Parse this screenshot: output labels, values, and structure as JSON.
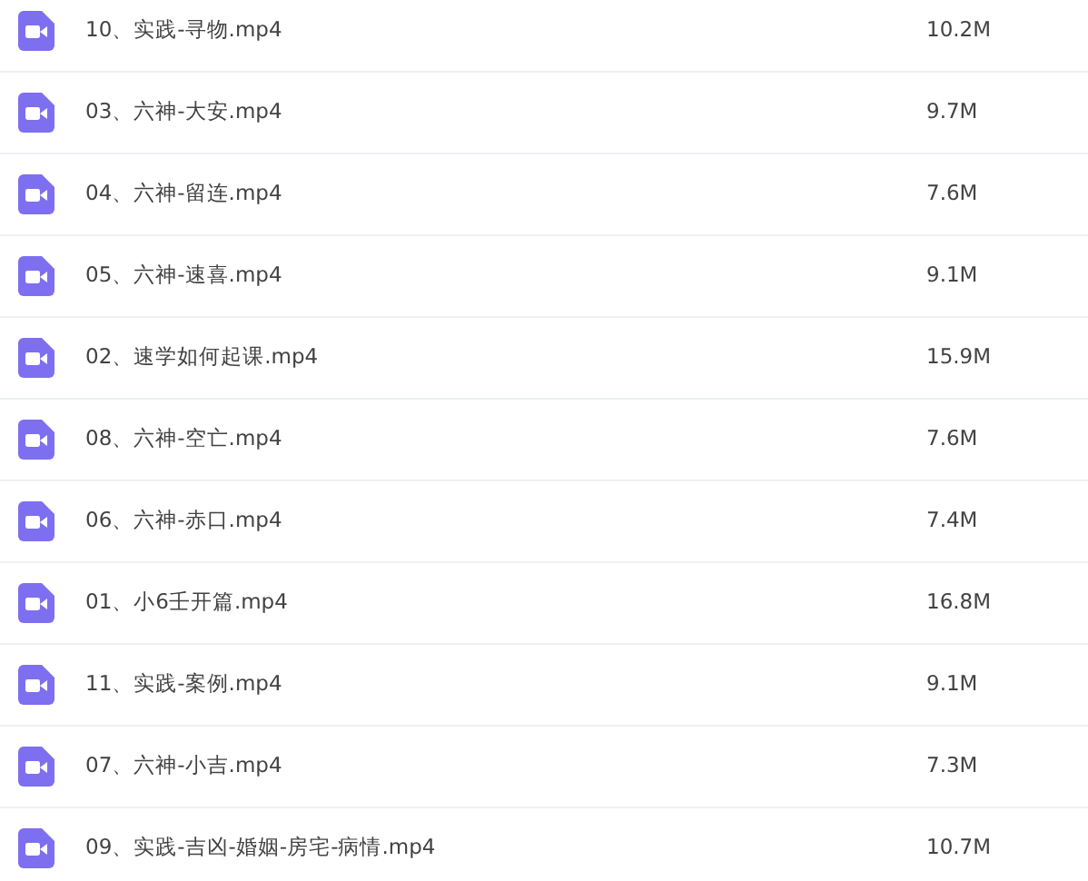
{
  "files": [
    {
      "name": "10、实践-寻物.mp4",
      "size": "10.2M"
    },
    {
      "name": "03、六神-大安.mp4",
      "size": "9.7M"
    },
    {
      "name": "04、六神-留连.mp4",
      "size": "7.6M"
    },
    {
      "name": "05、六神-速喜.mp4",
      "size": "9.1M"
    },
    {
      "name": "02、速学如何起课.mp4",
      "size": "15.9M"
    },
    {
      "name": "08、六神-空亡.mp4",
      "size": "7.6M"
    },
    {
      "name": "06、六神-赤口.mp4",
      "size": "7.4M"
    },
    {
      "name": "01、小6壬开篇.mp4",
      "size": "16.8M"
    },
    {
      "name": "11、实践-案例.mp4",
      "size": "9.1M"
    },
    {
      "name": "07、六神-小吉.mp4",
      "size": "7.3M"
    },
    {
      "name": "09、实践-吉凶-婚姻-房宅-病情.mp4",
      "size": "10.7M"
    }
  ]
}
